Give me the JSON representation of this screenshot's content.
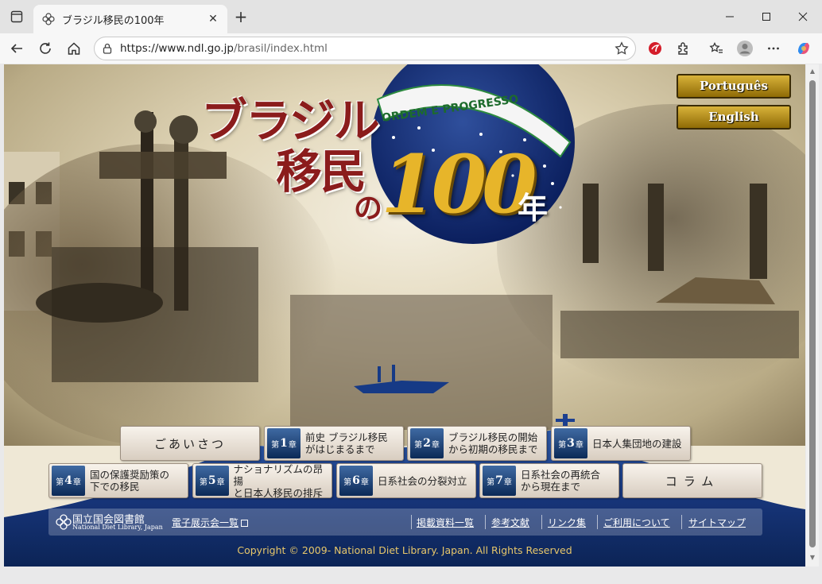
{
  "browser": {
    "tab_title": "ブラジル移民の100年",
    "url_host": "https://www.ndl.go.jp",
    "url_path": "/brasil/index.html"
  },
  "page": {
    "title_line1": "ブラジル",
    "title_line2": "移民",
    "title_no": "の",
    "title_100": "100",
    "title_nen": "年",
    "banner_text": "ORDEM E PROGRESSO",
    "languages": [
      "Português",
      "English"
    ],
    "nav_row1": [
      {
        "type": "plain",
        "label": "ごあいさつ"
      },
      {
        "type": "chapter",
        "prefix": "第",
        "num": "1",
        "suffix": "章",
        "line1": "前史 ブラジル移民",
        "line2": "がはじまるまで"
      },
      {
        "type": "chapter",
        "prefix": "第",
        "num": "2",
        "suffix": "章",
        "line1": "ブラジル移民の開始",
        "line2": "から初期の移民まで"
      },
      {
        "type": "chapter",
        "prefix": "第",
        "num": "3",
        "suffix": "章",
        "line1": "日本人集団地の建設",
        "line2": ""
      }
    ],
    "nav_row2": [
      {
        "type": "chapter",
        "prefix": "第",
        "num": "4",
        "suffix": "章",
        "line1": "国の保護奨励策の",
        "line2": "下での移民"
      },
      {
        "type": "chapter",
        "prefix": "第",
        "num": "5",
        "suffix": "章",
        "line1": "ナショナリズムの昂揚",
        "line2": "と日本人移民の排斥"
      },
      {
        "type": "chapter",
        "prefix": "第",
        "num": "6",
        "suffix": "章",
        "line1": "日系社会の分裂対立",
        "line2": ""
      },
      {
        "type": "chapter",
        "prefix": "第",
        "num": "7",
        "suffix": "章",
        "line1": "日系社会の再統合",
        "line2": "から現在まで"
      },
      {
        "type": "plain",
        "label": "コラム"
      }
    ],
    "footer": {
      "ndl_name_jp": "国立国会図書館",
      "ndl_name_en": "National Diet Library, Japan",
      "exhibition_link": "電子展示会一覧",
      "links": [
        "掲載資料一覧",
        "参考文献",
        "リンク集",
        "ご利用について",
        "サイトマップ"
      ]
    },
    "copyright": "Copyright © 2009- National Diet Library. Japan. All Rights Reserved"
  },
  "colors": {
    "title_red": "#8b1c1c",
    "gold": "#e7b52a",
    "navy": "#0e2a63"
  }
}
